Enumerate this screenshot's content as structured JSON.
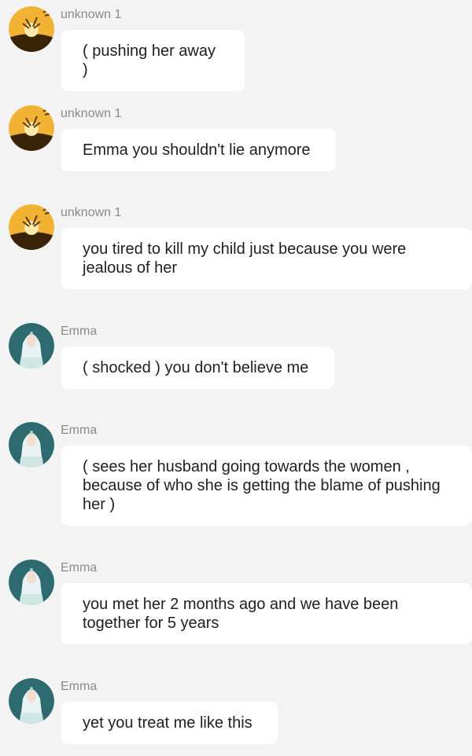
{
  "colors": {
    "background": "#f3f3f3",
    "bubble": "#ffffff",
    "sender_text": "#8a8a8a",
    "message_text": "#1f1f1f",
    "avatar_unknown_bg": "#f2b233",
    "avatar_emma_bg": "#2e6b70"
  },
  "messages": [
    {
      "sender": "unknown 1",
      "avatar_icon": "sun-cat-avatar-icon",
      "text": "( pushing her away )"
    },
    {
      "sender": "unknown 1",
      "avatar_icon": "sun-cat-avatar-icon",
      "text": "Emma you shouldn't lie anymore"
    },
    {
      "sender": "unknown 1",
      "avatar_icon": "sun-cat-avatar-icon",
      "text": "you tired to kill my child just because you were jealous of her"
    },
    {
      "sender": "Emma",
      "avatar_icon": "emma-avatar-icon",
      "text": "( shocked ) you don't believe me"
    },
    {
      "sender": "Emma",
      "avatar_icon": "emma-avatar-icon",
      "text": "( sees her husband going towards the women , because of who she is getting the blame of pushing her )"
    },
    {
      "sender": "Emma",
      "avatar_icon": "emma-avatar-icon",
      "text": "you met her 2 months ago and we have been together for 5 years"
    },
    {
      "sender": "Emma",
      "avatar_icon": "emma-avatar-icon",
      "text": "yet you treat me like this"
    }
  ]
}
